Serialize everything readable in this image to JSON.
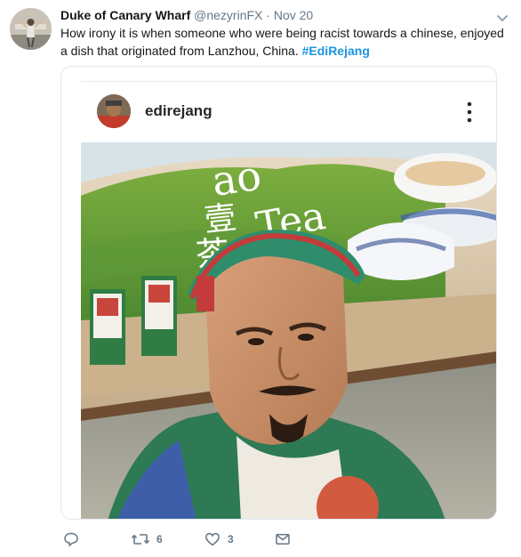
{
  "tweet": {
    "display_name": "Duke of Canary Wharf",
    "handle": "@nezyrinFX",
    "separator": "·",
    "time": "Nov 20",
    "text_part1": "How irony it is when someone who were being racist towards a chinese, enjoyed a dish that originated from Lanzhou, China. ",
    "hashtag": "#EdiRejang"
  },
  "embedded_post": {
    "username": "edirejang",
    "sign_text": {
      "top": "ao",
      "chinese": "茶",
      "chinese2": "壹",
      "tea": "Tea"
    }
  },
  "actions": {
    "replies": "",
    "retweets": "6",
    "likes": "3"
  },
  "icons": {
    "reply": "reply-icon",
    "retweet": "retweet-icon",
    "like": "heart-icon",
    "dm": "envelope-icon",
    "caret": "chevron-down-icon",
    "more": "vertical-dots-icon"
  },
  "colors": {
    "link": "#1b95e0",
    "secondary": "#657786",
    "text": "#14171a"
  }
}
